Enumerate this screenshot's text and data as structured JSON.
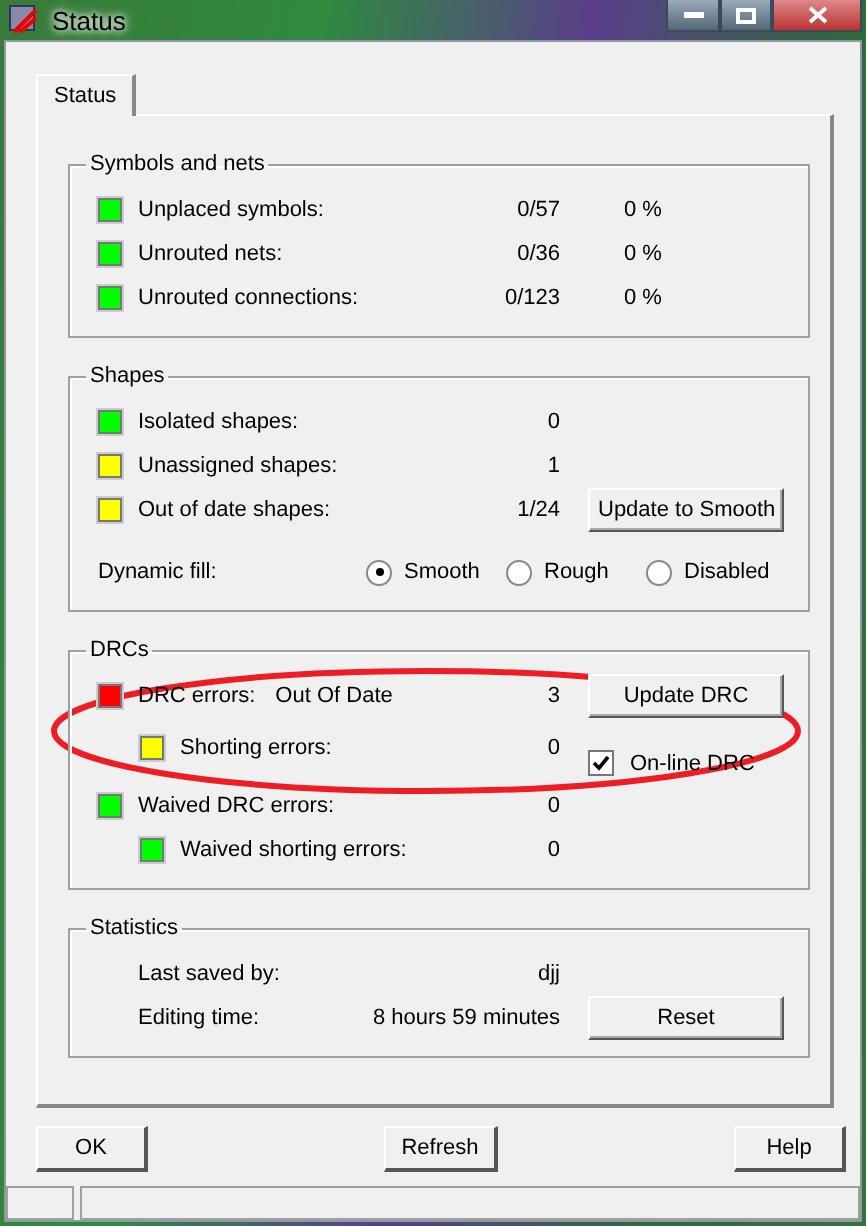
{
  "window": {
    "title": "Status"
  },
  "tabs": [
    {
      "label": "Status",
      "selected": true
    }
  ],
  "groups": [
    {
      "title": "Symbols and nets",
      "rows": [
        {
          "label": "Unplaced symbols:",
          "value": "0/57",
          "percent": "0 %",
          "color": "#00ff00"
        },
        {
          "label": "Unrouted nets:",
          "value": "0/36",
          "percent": "0 %",
          "color": "#00ff00"
        },
        {
          "label": "Unrouted connections:",
          "value": "0/123",
          "percent": "0 %",
          "color": "#00ff00"
        }
      ]
    },
    {
      "title": "Shapes",
      "rows": [
        {
          "label": "Isolated shapes:",
          "value": "0",
          "color": "#00ff00"
        },
        {
          "label": "Unassigned shapes:",
          "value": "1",
          "color": "#ffff00"
        },
        {
          "label": "Out of date shapes:",
          "value": "1/24",
          "color": "#ffff00",
          "button": "Update to Smooth"
        }
      ],
      "fill": {
        "label": "Dynamic fill:",
        "options": [
          {
            "label": "Smooth",
            "selected": true
          },
          {
            "label": "Rough",
            "selected": false
          },
          {
            "label": "Disabled",
            "selected": false
          }
        ]
      }
    },
    {
      "title": "DRCs",
      "rows": [
        {
          "label": "DRC errors:",
          "note": "Out Of Date",
          "value": "3",
          "color": "#ff0000",
          "button": "Update DRC",
          "children": [
            {
              "label": "Shorting errors:",
              "value": "0",
              "color": "#ffff00",
              "checkbox": {
                "label": "On-line DRC",
                "checked": true
              }
            }
          ]
        },
        {
          "label": "Waived DRC errors:",
          "value": "0",
          "color": "#00ff00",
          "children": [
            {
              "label": "Waived shorting errors:",
              "value": "0",
              "color": "#00ff00"
            }
          ]
        }
      ]
    },
    {
      "title": "Statistics",
      "rows": [
        {
          "label": "Last saved by:",
          "value": "djj"
        },
        {
          "label": "Editing time:",
          "value": "8 hours 59 minutes",
          "button": "Reset"
        }
      ]
    }
  ],
  "buttons": [
    "OK",
    "Refresh",
    "Help"
  ]
}
